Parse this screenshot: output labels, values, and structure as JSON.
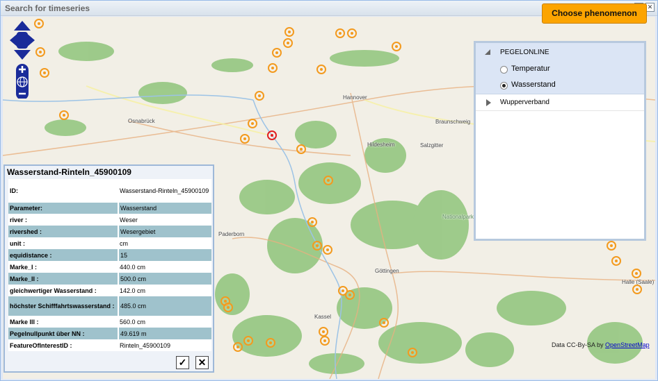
{
  "window": {
    "title": "Search for timeseries",
    "maximize_icon": "restore-icon",
    "close_icon": "close-icon"
  },
  "map": {
    "cities": [
      "Osnabrück",
      "Hannover",
      "Braunschweig",
      "Hildesheim",
      "Salzgitter",
      "Paderborn",
      "Göttingen",
      "Kassel",
      "Halle (Saale)",
      "Nationalpark Harz"
    ],
    "attribution_prefix": "Data CC-By-SA by",
    "attribution_link": "OpenStreetMap"
  },
  "phenomenon": {
    "button_label": "Choose phenomenon",
    "groups": [
      {
        "label": "PEGELONLINE",
        "expanded": true,
        "options": [
          {
            "label": "Temperatur",
            "selected": false
          },
          {
            "label": "Wasserstand",
            "selected": true
          }
        ]
      },
      {
        "label": "Wupperverband",
        "expanded": false
      }
    ]
  },
  "info": {
    "title": "Wasserstand-Rinteln_45900109",
    "rows": [
      {
        "key": "ID:",
        "value": "Wasserstand-Rinteln_45900109"
      },
      {
        "key": "Parameter:",
        "value": "Wasserstand"
      },
      {
        "key": "river :",
        "value": "Weser"
      },
      {
        "key": "rivershed :",
        "value": "Wesergebiet"
      },
      {
        "key": "unit :",
        "value": "cm"
      },
      {
        "key": "equidistance :",
        "value": "15"
      },
      {
        "key": "Marke_I :",
        "value": "440.0 cm"
      },
      {
        "key": "Marke_II :",
        "value": "500.0 cm"
      },
      {
        "key": "gleichwertiger Wasserstand :",
        "value": "142.0 cm"
      },
      {
        "key": "höchster Schifffahrtswasserstand :",
        "value": "485.0 cm"
      },
      {
        "key": "Marke III :",
        "value": "560.0 cm"
      },
      {
        "key": "Pegelnullpunkt über NN :",
        "value": "49.619 m"
      },
      {
        "key": "FeatureOfInterestID :",
        "value": "Rinteln_45900109"
      }
    ],
    "confirm_icon": "checkmark-icon",
    "cancel_icon": "x-icon"
  },
  "colors": {
    "marker": "#f39a1e",
    "selected_marker": "#e02020",
    "button": "#fca400",
    "nav_control": "#1a2b9a"
  }
}
